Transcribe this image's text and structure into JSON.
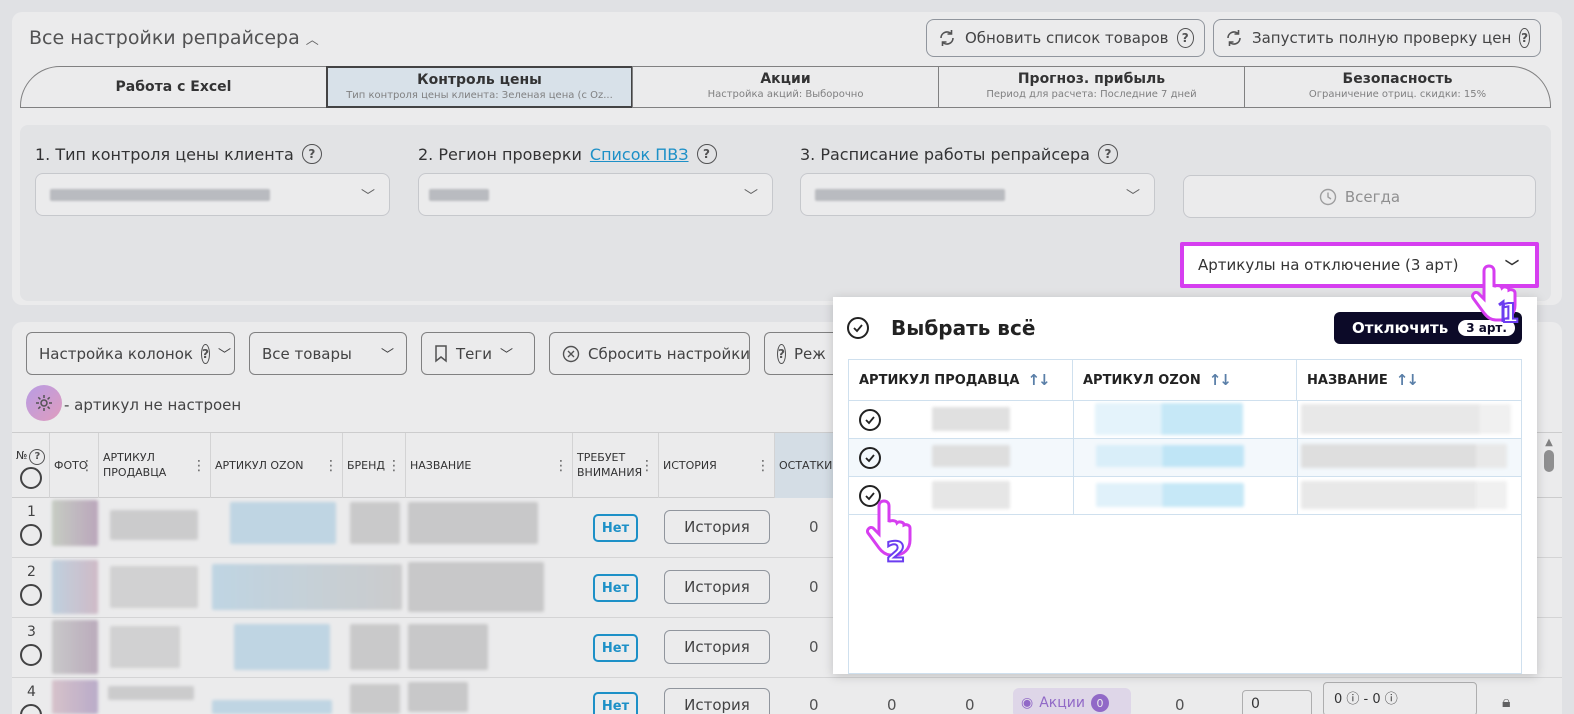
{
  "header": {
    "title": "Все настройки репрайсера",
    "refresh_button": "Обновить список товаров",
    "full_check_button": "Запустить полную проверку цен"
  },
  "tabs": [
    {
      "label": "Работа с Excel",
      "sub": ""
    },
    {
      "label": "Контроль цены",
      "sub": "Тип контроля цены клиента: Зеленая цена (с Oz..."
    },
    {
      "label": "Акции",
      "sub": "Настройка акций: Выборочно"
    },
    {
      "label": "Прогноз. прибыль",
      "sub": "Период для расчета: Последние 7 дней"
    },
    {
      "label": "Безопасность",
      "sub": "Ограничение отриц. скидки: 15%"
    }
  ],
  "settings": {
    "field1_label": "1. Тип контроля цены клиента",
    "field2_label": "2. Регион проверки",
    "field2_link": "Список ПВЗ",
    "field3_label": "3. Расписание работы репрайсера",
    "always_label": "Всегда",
    "articles_dropdown": "Артикулы на отключение (3 арт)"
  },
  "toolbar": {
    "columns_label": "Настройка колонок",
    "all_goods_label": "Все товары",
    "tags_label": "Теги",
    "reset_label": "Сбросить настройки",
    "mode_label": "Реж",
    "not_configured_label": "- артикул не настроен"
  },
  "table": {
    "headers": [
      "№",
      "ФОТО",
      "АРТИКУЛ ПРОДАВЦА",
      "АРТИКУЛ OZON",
      "БРЕНД",
      "НАЗВАНИЕ",
      "ТРЕБУЕТ ВНИМАНИЯ",
      "ИСТОРИЯ",
      "ОСТАТКИ"
    ],
    "rows": [
      {
        "num": "1",
        "attention": "Нет",
        "history": "История",
        "stock": "0"
      },
      {
        "num": "2",
        "attention": "Нет",
        "history": "История",
        "stock": "0"
      },
      {
        "num": "3",
        "attention": "Нет",
        "history": "История",
        "stock": "0"
      },
      {
        "num": "4",
        "attention": "Нет",
        "history": "История",
        "stock": "0",
        "col2": "0",
        "col3": "0",
        "promo": "Акции",
        "promo_count": "0",
        "col5": "0",
        "input_value": "0",
        "range": "0 ⓘ - 0 ⓘ"
      }
    ]
  },
  "popup": {
    "select_all": "Выбрать всё",
    "disable_button": "Отключить",
    "disable_count": "3 арт.",
    "columns": [
      "АРТИКУЛ ПРОДАВЦА",
      "АРТИКУЛ OZON",
      "НАЗВАНИЕ"
    ],
    "row_count": 3
  },
  "annotations": {
    "step1": "1",
    "step2": "2"
  },
  "colors": {
    "accent": "#1a9ad6",
    "highlight": "#d63ef0",
    "dark_button": "#0c0a28"
  }
}
